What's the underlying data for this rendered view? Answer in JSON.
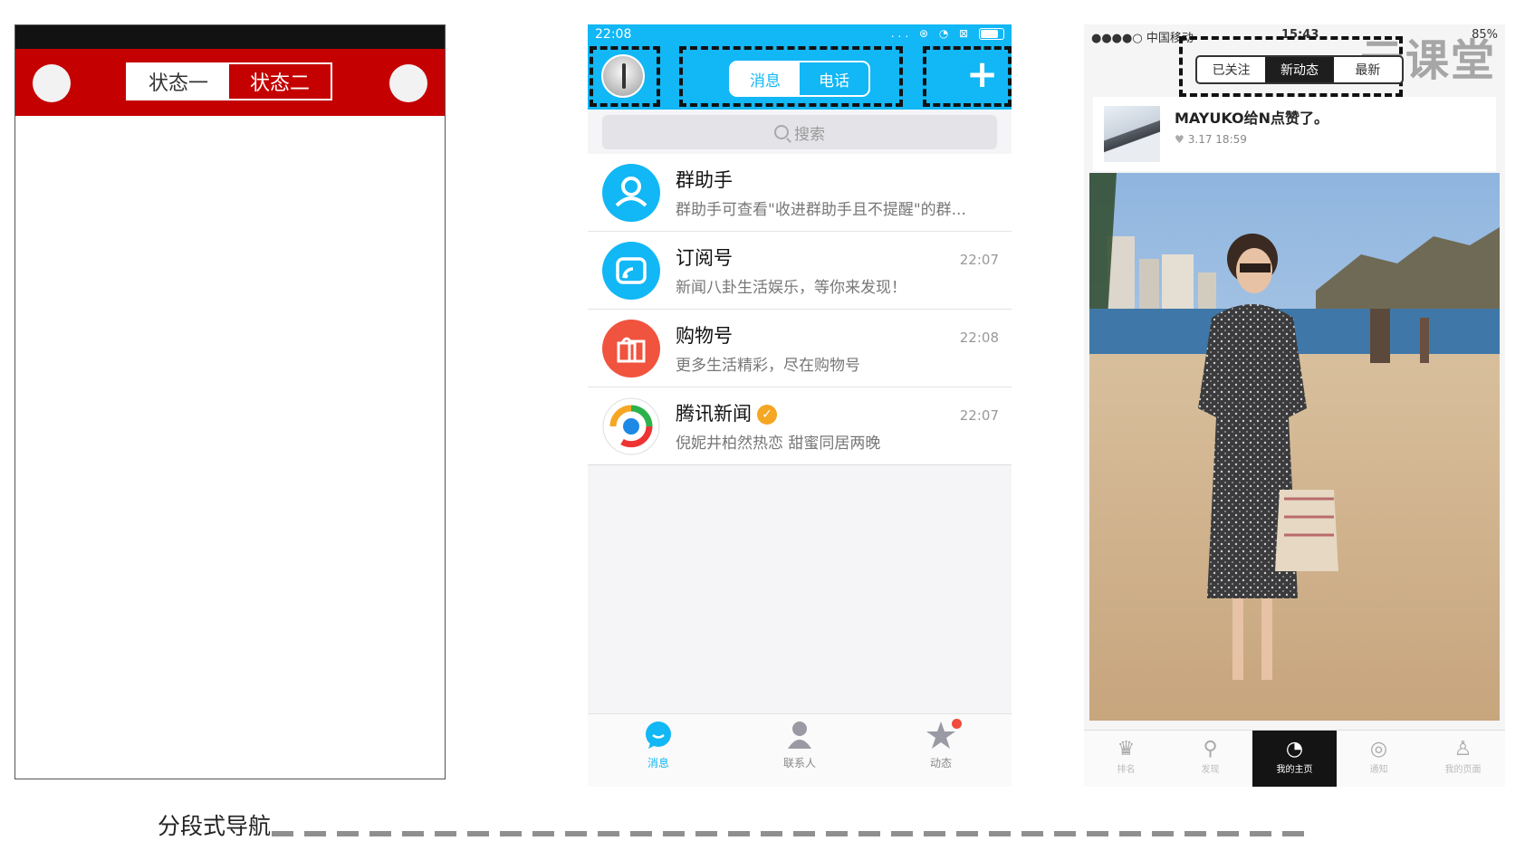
{
  "wireframe": {
    "segment": [
      "状态一",
      "状态二"
    ],
    "caption": "分段式导航"
  },
  "qq": {
    "status_time": "22:08",
    "status_icons": "... ⊛ ◔ ⊠",
    "segment": [
      "消息",
      "电话"
    ],
    "plus": "+",
    "search_placeholder": "搜索",
    "chats": [
      {
        "name": "群助手",
        "preview": "群助手可查看\"收进群助手且不提醒\"的群...",
        "time": "",
        "icon": "group-helper-icon",
        "color": "#12b7f5"
      },
      {
        "name": "订阅号",
        "preview": "新闻八卦生活娱乐，等你来发现！",
        "time": "22:07",
        "icon": "subscription-icon",
        "color": "#12b7f5"
      },
      {
        "name": "购物号",
        "preview": "更多生活精彩，尽在购物号",
        "time": "22:08",
        "icon": "shopping-bag-icon",
        "color": "#f0533e"
      },
      {
        "name": "腾讯新闻",
        "preview": "倪妮井柏然热恋 甜蜜同居两晚",
        "time": "22:07",
        "icon": "tencent-news-icon",
        "color": "#ffffff"
      }
    ],
    "tabs": [
      "消息",
      "联系人",
      "动态"
    ],
    "accent": "#12b7f5"
  },
  "photoapp": {
    "carrier": "●●●●○ 中国移动",
    "time": "15:43",
    "battery": "85%",
    "watermark": "云课堂",
    "segment": [
      "已关注",
      "新动态",
      "最新"
    ],
    "notification": {
      "title": "MAYUKO给N点赞了。",
      "time": "3.17 18:59"
    },
    "tabs": [
      "排名",
      "发现",
      "我的主页",
      "通知",
      "我的页面"
    ]
  }
}
